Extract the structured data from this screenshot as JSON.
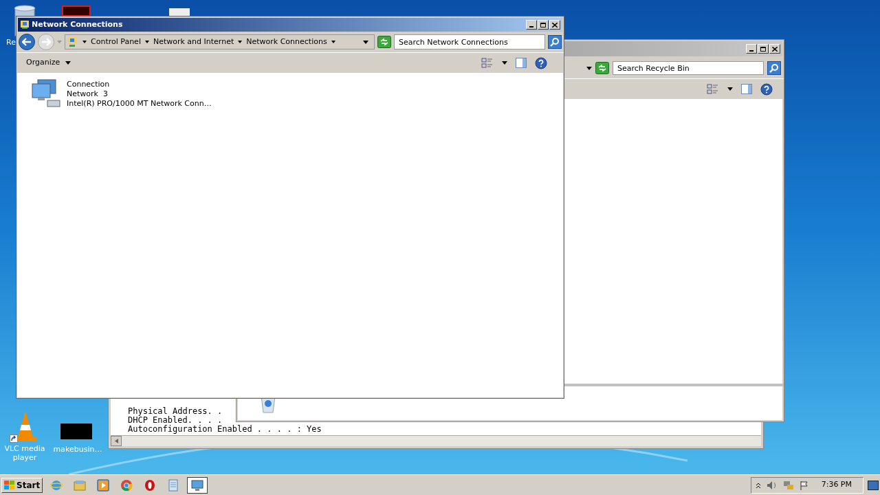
{
  "desktop_icons": [
    {
      "label": "Re"
    },
    {
      "label": "VLC media player"
    },
    {
      "label": "makebusin…"
    }
  ],
  "console": {
    "lines": [
      "Physical Address. .",
      "DHCP Enabled. . . .",
      "Autoconfiguration Enabled . . . . : Yes"
    ]
  },
  "recycle_window": {
    "search": {
      "placeholder": "Search Recycle Bin"
    }
  },
  "network_window": {
    "title": "Network Connections",
    "breadcrumbs": [
      "Control Panel",
      "Network and Internet",
      "Network Connections"
    ],
    "search": {
      "placeholder": "Search Network Connections"
    },
    "organize": "Organize",
    "items": [
      {
        "name": "Connection",
        "network": "Network  3",
        "adapter": "Intel(R) PRO/1000 MT Network Conn…"
      }
    ]
  },
  "taskbar": {
    "start": "Start",
    "apps": [
      {
        "kind": "ie",
        "selected": false
      },
      {
        "kind": "explorer",
        "selected": false
      },
      {
        "kind": "media",
        "selected": false
      },
      {
        "kind": "chrome",
        "selected": false
      },
      {
        "kind": "opera",
        "selected": false
      },
      {
        "kind": "notepad",
        "selected": false
      },
      {
        "kind": "network",
        "selected": true
      }
    ],
    "clock": "7:36 PM"
  }
}
